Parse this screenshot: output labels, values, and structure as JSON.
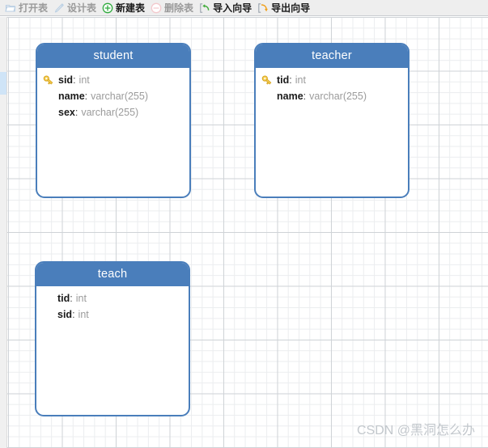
{
  "toolbar": {
    "items": [
      {
        "label": "打开表",
        "icon": "folder-open-icon",
        "enabled": false
      },
      {
        "label": "设计表",
        "icon": "pencil-design-icon",
        "enabled": false
      },
      {
        "label": "新建表",
        "icon": "plus-circle-icon",
        "enabled": true
      },
      {
        "label": "删除表",
        "icon": "minus-circle-icon",
        "enabled": false
      },
      {
        "label": "导入向导",
        "icon": "import-arrow-icon",
        "enabled": true
      },
      {
        "label": "导出向导",
        "icon": "export-arrow-icon",
        "enabled": true
      }
    ]
  },
  "colors": {
    "accent_blue": "#4a7ebb",
    "toolbar_bg": "#eeeeee",
    "grid_minor": "#ebedef",
    "grid_major": "#cfd3d7",
    "key_gold": "#f0c040",
    "type_gray": "#9b9b9b",
    "scroll_thumb": "#cfe4f7"
  },
  "canvas": {
    "tables": [
      {
        "name": "student",
        "fields": [
          {
            "name": "sid",
            "type": "int",
            "primary_key": true
          },
          {
            "name": "name",
            "type": "varchar(255)",
            "primary_key": false
          },
          {
            "name": "sex",
            "type": "varchar(255)",
            "primary_key": false
          }
        ]
      },
      {
        "name": "teacher",
        "fields": [
          {
            "name": "tid",
            "type": "int",
            "primary_key": true
          },
          {
            "name": "name",
            "type": "varchar(255)",
            "primary_key": false
          }
        ]
      },
      {
        "name": "teach",
        "fields": [
          {
            "name": "tid",
            "type": "int",
            "primary_key": false
          },
          {
            "name": "sid",
            "type": "int",
            "primary_key": false
          }
        ]
      }
    ]
  },
  "watermark": {
    "text": "CSDN @黑洞怎么办"
  }
}
